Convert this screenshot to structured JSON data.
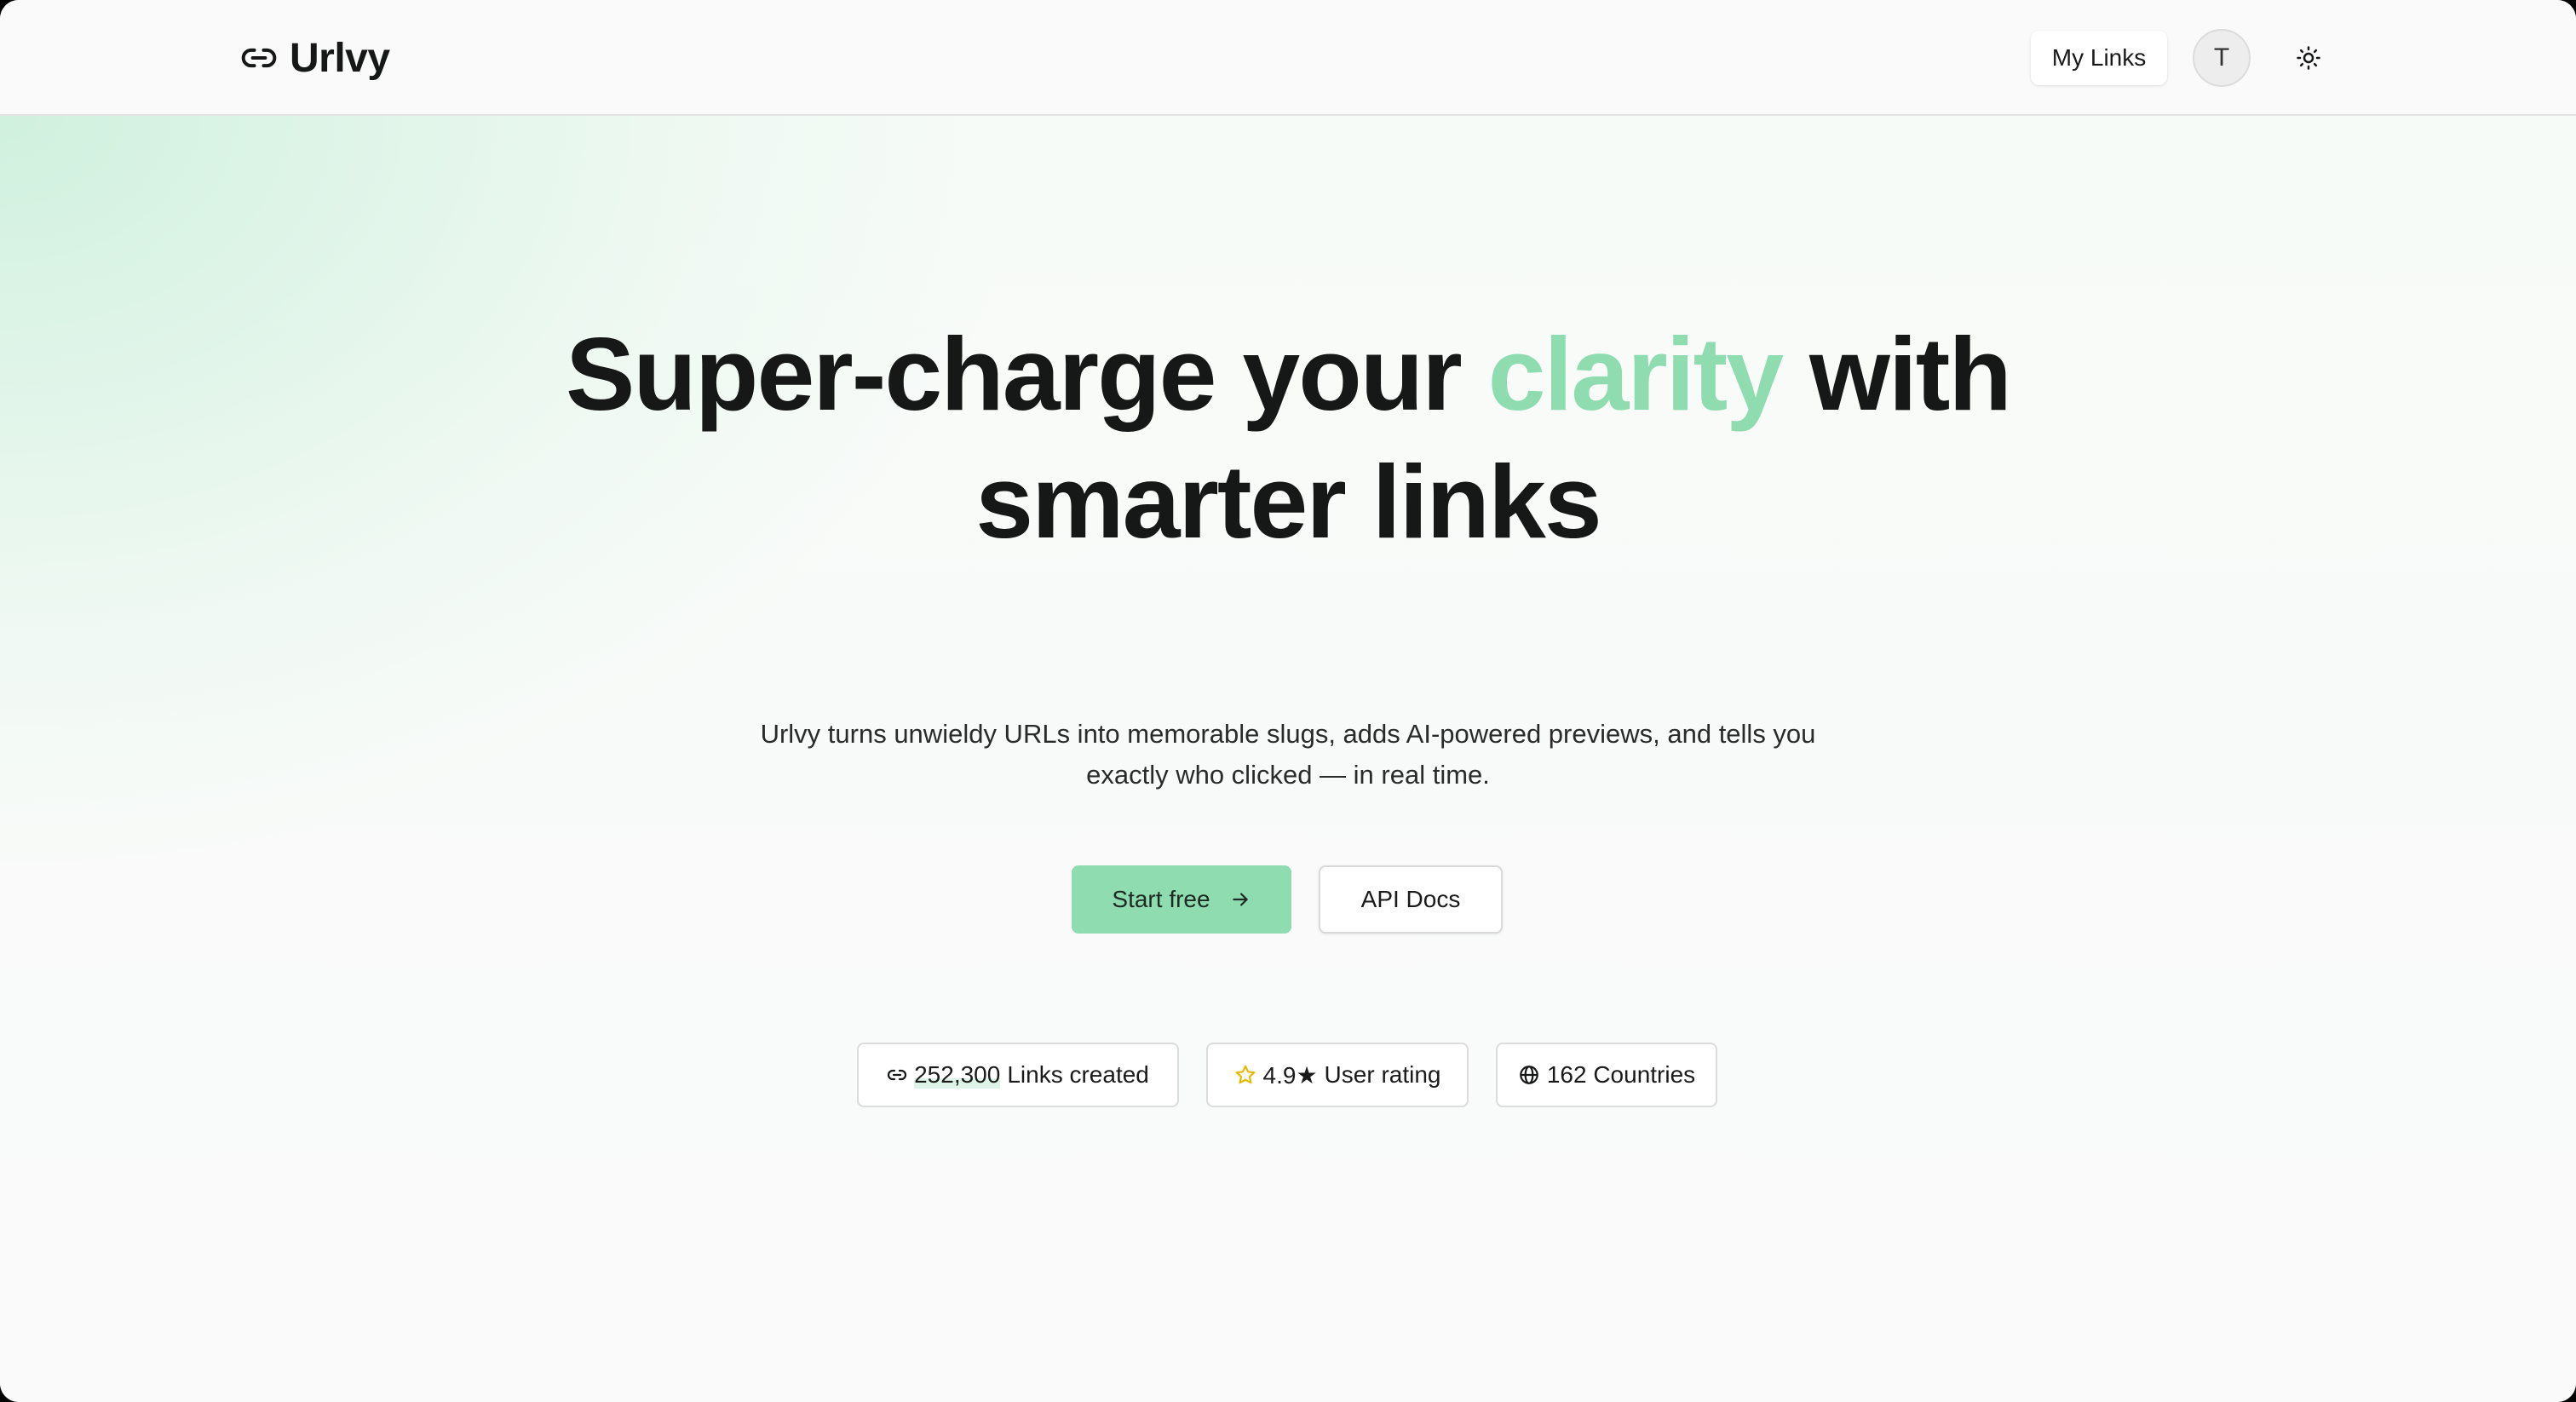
{
  "header": {
    "brand": "Urlvy",
    "my_links": "My Links",
    "avatar_initial": "T",
    "icons": {
      "brand": "link-icon",
      "theme_toggle": "sun-icon"
    }
  },
  "hero": {
    "headline_pre": "Super-charge your",
    "headline_accent": "clarity",
    "headline_post": "with",
    "headline_line2": "smarter links",
    "subtext_line1": "Urlvy turns unwieldy URLs into memorable slugs, adds AI-powered previews, and tells you",
    "subtext_line2": "exactly who clicked — in real time.",
    "primary_cta": "Start free",
    "secondary_cta": "API Docs"
  },
  "stats": {
    "links_count": "252,300",
    "links_label": "Links created",
    "rating_value": "4.9★",
    "rating_label": "User rating",
    "countries": "162 Countries"
  },
  "colors": {
    "accent": "#8fdcb0",
    "text": "#161717",
    "background": "#fafafa",
    "star": "#e6b800"
  }
}
